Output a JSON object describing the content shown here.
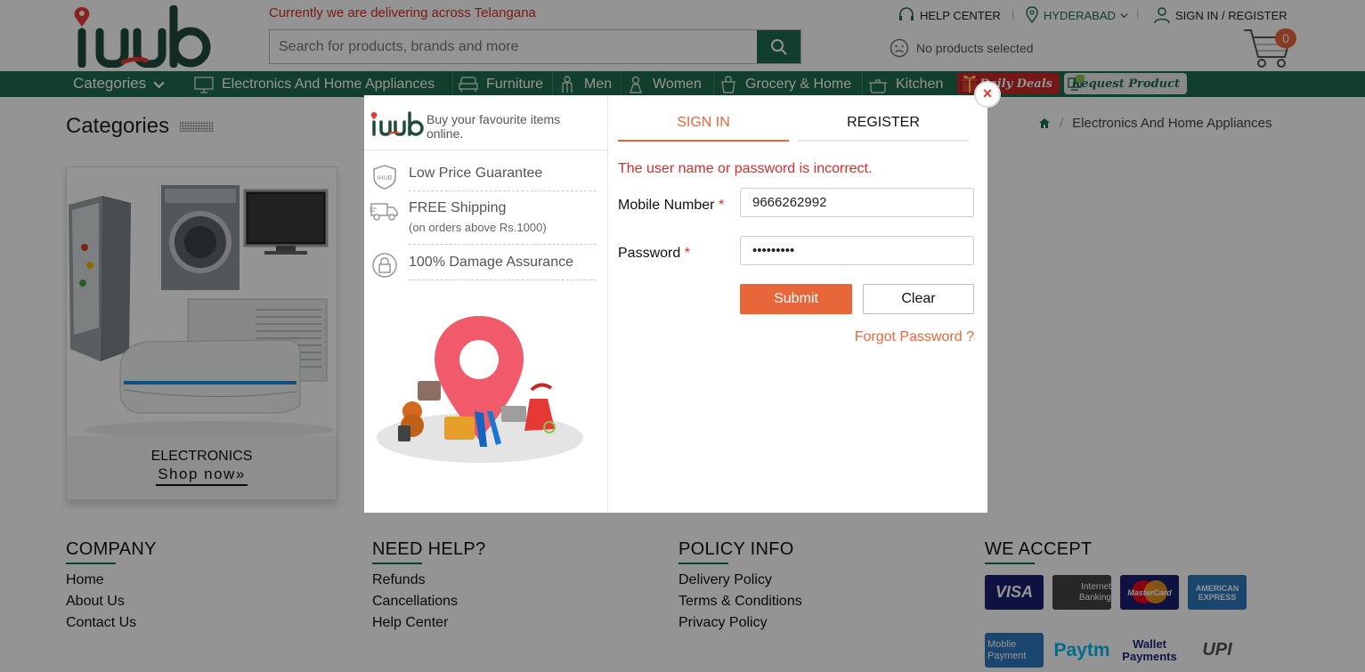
{
  "header": {
    "brand": "ihub",
    "delivery_text": "Currently we are delivering across Telangana",
    "search_placeholder": "Search for products, brands and more",
    "help_center": "HELP CENTER",
    "location": "HYDERABAD",
    "sign_in": "SIGN IN / REGISTER",
    "no_products": "No products selected",
    "cart_count": "0"
  },
  "nav": {
    "categories_label": "Categories",
    "items": [
      "Electronics And Home Appliances",
      "Furniture",
      "Men",
      "Women",
      "Grocery & Home",
      "Kitchen"
    ],
    "daily_deals": "Daily Deals",
    "request_product": "Request Product"
  },
  "page": {
    "title": "Categories",
    "breadcrumb_current": "Electronics And Home Appliances",
    "card_label": "ELECTRONICS",
    "card_link": "Shop now»"
  },
  "footer": {
    "company": {
      "title": "COMPANY",
      "links": [
        "Home",
        "About Us",
        "Contact Us"
      ]
    },
    "help": {
      "title": "NEED HELP?",
      "links": [
        "Refunds",
        "Cancellations",
        "Help Center"
      ]
    },
    "policy": {
      "title": "POLICY INFO",
      "links": [
        "Delivery Policy",
        "Terms & Conditions",
        "Privacy Policy"
      ]
    },
    "accept": {
      "title": "WE ACCEPT",
      "methods": [
        "VISA",
        "Internet Banking",
        "MasterCard",
        "AMERICAN EXPRESS",
        "Moblie Payment",
        "Paytm",
        "Wallet Payments",
        "UPI"
      ]
    }
  },
  "modal": {
    "tagline": "Buy your favourite items online.",
    "features": [
      {
        "title": "Low Price Guarantee",
        "sub": ""
      },
      {
        "title": "FREE Shipping",
        "sub": "(on orders above Rs.1000)"
      },
      {
        "title": "100% Damage Assurance",
        "sub": ""
      }
    ],
    "tab_signin": "SIGN IN",
    "tab_register": "REGISTER",
    "error": "The user name or password is incorrect.",
    "mobile_label": "Mobile Number",
    "mobile_value": "9666262992",
    "password_label": "Password",
    "password_value": "•••••••••",
    "required_mark": "*",
    "submit": "Submit",
    "clear": "Clear",
    "forgot": "Forgot Password ?",
    "close_symbol": "×"
  },
  "colors": {
    "brand_green": "#1f6b4e",
    "accent_orange": "#e8673a",
    "error_red": "#d32f2f"
  }
}
